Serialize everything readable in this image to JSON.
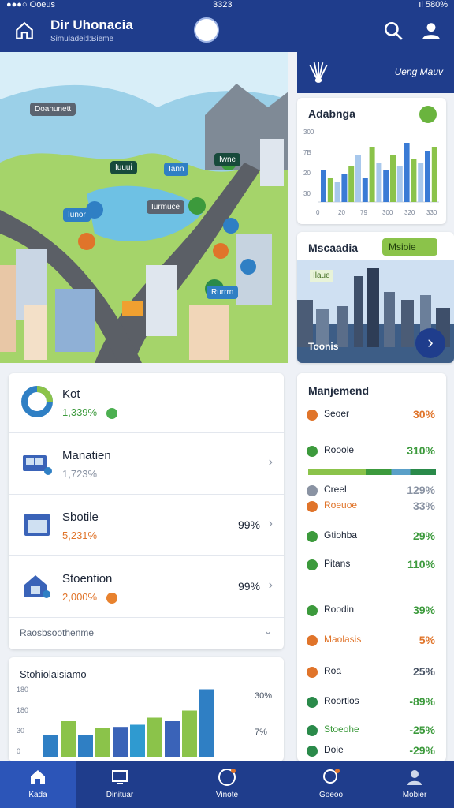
{
  "status": {
    "left": "●●●○ Ooeus",
    "center": "3323",
    "right": "ıl 580%"
  },
  "header": {
    "title": "Dir Uhonacia",
    "subtitle": "Simuladei:l:Bieme"
  },
  "map": {
    "labels": [
      "Doanunett",
      "Iuuui",
      "Iann",
      "Iunor",
      "Iurmuce",
      "Iwne",
      "Rurrrn"
    ]
  },
  "right_header": {
    "text": "Ueng Mauv"
  },
  "chart_card": {
    "title": "Adabnga",
    "chart_data": {
      "type": "bar",
      "categories": [
        "0",
        "20",
        "79",
        "300",
        "320",
        "330"
      ],
      "series": [
        {
          "values": [
            8,
            6,
            5,
            7,
            9,
            12,
            6,
            14,
            10,
            8,
            12,
            9,
            15,
            11,
            10,
            13,
            14
          ]
        }
      ],
      "ylabels": [
        "300",
        "7B",
        "20",
        "30"
      ],
      "colors": [
        "#3a7bd5",
        "#8bc34a",
        "#a8c8ec"
      ]
    }
  },
  "promo_card": {
    "title": "Mscaadia",
    "button": "Msioie",
    "tag": "Ilaue",
    "caption": "Toonis"
  },
  "list": {
    "rows": [
      {
        "name": "Kot",
        "value": "1,339%",
        "value_color": "#3c9a3c",
        "dot_color": "#4caf50",
        "pct": ""
      },
      {
        "name": "Manatien",
        "value": "1,723%",
        "value_color": "#8a93a3",
        "dot_color": "",
        "pct": ""
      },
      {
        "name": "Sbotile",
        "value": "5,231%",
        "value_color": "#e0742a",
        "dot_color": "",
        "pct": "99%"
      },
      {
        "name": "Stoention",
        "value": "2,000%",
        "value_color": "#e0742a",
        "dot_color": "#e8822e",
        "pct": "99%"
      }
    ],
    "footer": "Raosbsoothenme"
  },
  "bottom_chart": {
    "title": "Stohiolaisiamo",
    "ylabels": [
      "180",
      "180",
      "30",
      "0"
    ],
    "right_labels": [
      "30%",
      "7%"
    ],
    "chart_data": {
      "type": "bar",
      "series": [
        {
          "values": [
            30,
            50,
            30,
            40,
            42,
            45,
            55,
            50,
            65,
            95
          ]
        }
      ]
    }
  },
  "management": {
    "title": "Manjemend",
    "rows": [
      {
        "name": "Seoer",
        "value": "30%",
        "color": "#e0742a",
        "name_color": "#1b2435"
      },
      {
        "name": "Rooole",
        "value": "310%",
        "color": "#3c9a3c",
        "name_color": "#1b2435"
      },
      {
        "name": "Creel",
        "value": "129%",
        "color": "#8a93a3",
        "name_color": "#1b2435"
      },
      {
        "name": "Roeuoe",
        "value": "33%",
        "color": "#8a93a3",
        "name_color": "#e0742a"
      },
      {
        "name": "Gtiohba",
        "value": "29%",
        "color": "#3c9a3c",
        "name_color": "#1b2435"
      },
      {
        "name": "Pitans",
        "value": "110%",
        "color": "#3c9a3c",
        "name_color": "#1b2435"
      },
      {
        "name": "Roodin",
        "value": "39%",
        "color": "#3c9a3c",
        "name_color": "#1b2435"
      },
      {
        "name": "Maolasis",
        "value": "5%",
        "color": "#e0742a",
        "name_color": "#e0742a"
      },
      {
        "name": "Roa",
        "value": "25%",
        "color": "#4a5566",
        "name_color": "#1b2435"
      },
      {
        "name": "Roortios",
        "value": "-89%",
        "color": "#3c9a3c",
        "name_color": "#1b2435"
      },
      {
        "name": "Stoeohe",
        "value": "-25%",
        "color": "#3c9a3c",
        "name_color": "#3c9a3c"
      },
      {
        "name": "Doie",
        "value": "-29%",
        "color": "#3c9a3c",
        "name_color": "#1b2435"
      }
    ]
  },
  "nav": {
    "tabs": [
      "Kada",
      "Dinituar",
      "Vinote",
      "Goeoo",
      "Mobier"
    ]
  }
}
